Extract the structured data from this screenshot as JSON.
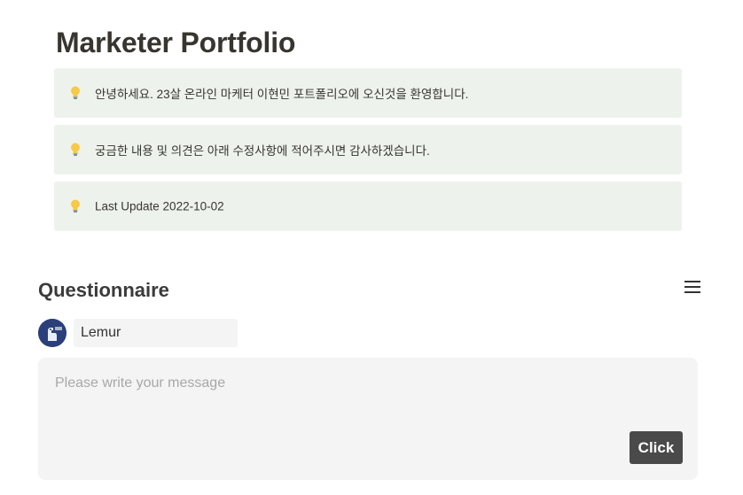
{
  "page": {
    "title": "Marketer Portfolio"
  },
  "callouts": [
    {
      "icon": "light-bulb-icon",
      "text": "안녕하세요. 23살 온라인 마케터 이현민 포트폴리오에 오신것을 환영합니다."
    },
    {
      "icon": "light-bulb-icon",
      "text": "궁금한 내용 및 의견은 아래 수정사항에 적어주시면 감사하겠습니다."
    },
    {
      "icon": "light-bulb-icon",
      "text": "Last Update 2022-10-02"
    }
  ],
  "questionnaire": {
    "title": "Questionnaire",
    "menu_icon": "hamburger-menu-icon",
    "name_value": "Lemur",
    "message_placeholder": "Please write your message",
    "submit_label": "Click"
  },
  "colors": {
    "callout_bg": "#edf3ec",
    "title_text": "#37352f",
    "button_bg": "#4a4a4a",
    "input_bg": "#f4f4f4",
    "avatar_bg": "#2c3f7a"
  }
}
